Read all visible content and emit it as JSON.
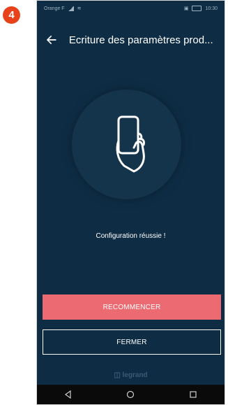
{
  "step": {
    "number": "4",
    "color": "#e8421b"
  },
  "status_bar": {
    "carrier": "Orange F",
    "time": "10:30"
  },
  "header": {
    "title": "Ecriture des paramètres prod..."
  },
  "illustration": {
    "icon": "phone-in-hand-icon"
  },
  "message": {
    "text": "Configuration réussie !"
  },
  "buttons": {
    "restart_label": "RECOMMENCER",
    "close_label": "FERMER"
  },
  "brand": {
    "text": "legrand"
  },
  "colors": {
    "background": "#0e2d45",
    "accent": "#ec6b73",
    "badge": "#e8421b"
  },
  "nav": {
    "icons": [
      "back-triangle-icon",
      "home-circle-icon",
      "recents-square-icon"
    ]
  }
}
